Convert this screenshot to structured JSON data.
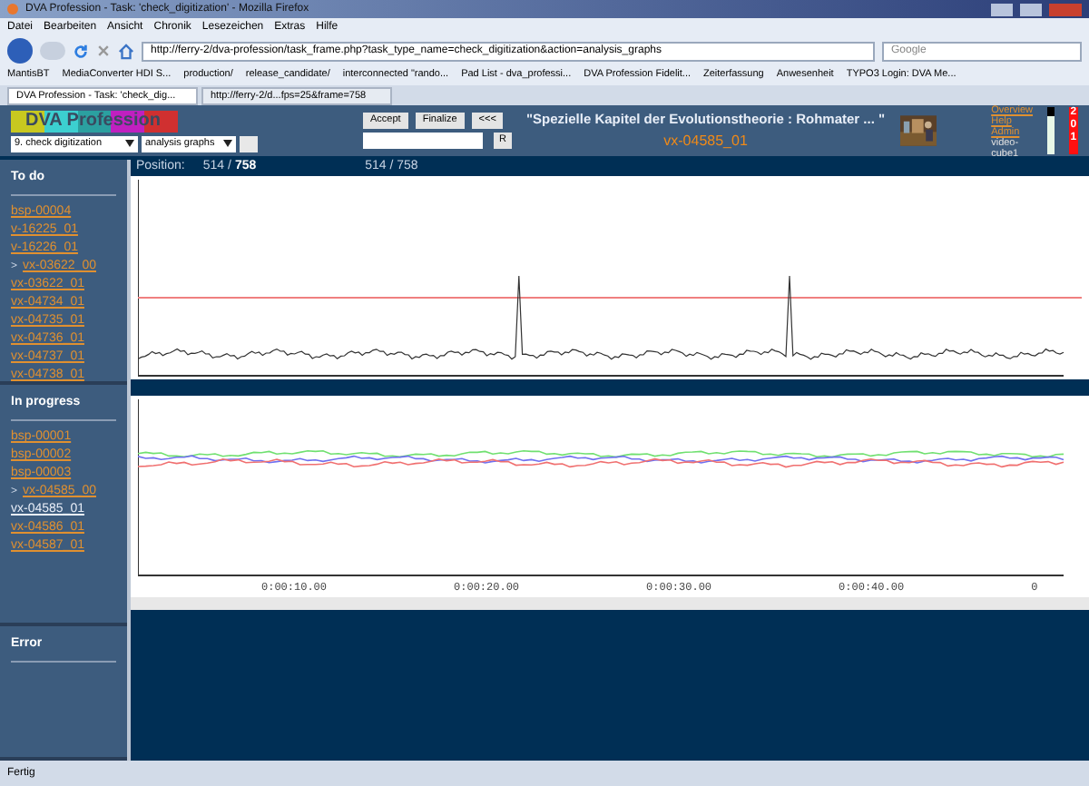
{
  "browser": {
    "title": "DVA Profession - Task: 'check_digitization' - Mozilla Firefox",
    "menu": [
      "Datei",
      "Bearbeiten",
      "Ansicht",
      "Chronik",
      "Lesezeichen",
      "Extras",
      "Hilfe"
    ],
    "url": "http://ferry-2/dva-profession/task_frame.php?task_type_name=check_digitization&action=analysis_graphs",
    "search": {
      "placeholder": "Google"
    },
    "bookmarks": [
      "MantisBT",
      "MediaConverter HDI S...",
      "production/",
      "release_candidate/",
      "interconnected \"rando...",
      "Pad List - dva_professi...",
      "DVA Profession Fidelit...",
      "Zeiterfassung",
      "Anwesenheit",
      "TYPO3 Login: DVA Me..."
    ],
    "tabs": [
      {
        "label": "DVA Profession - Task: 'check_dig...",
        "selected": true
      },
      {
        "label": "http://ferry-2/d...fps=25&frame=758",
        "selected": false
      }
    ],
    "status": "Fertig"
  },
  "header": {
    "logo": "DVA Profession",
    "selects": [
      "9. check digitization",
      "analysis graphs"
    ],
    "buttons": [
      "Accept",
      "Finalize",
      "<<<"
    ],
    "reset": "R",
    "title": "\"Spezielle Kapitel der Evolutionstheorie : Rohmater ... \"",
    "video_id": "vx-04585_01",
    "links": [
      "Overview",
      "Help",
      "Admin"
    ],
    "user": "video-cube1",
    "counter": "201"
  },
  "sidebar": [
    {
      "title": "To do",
      "items": [
        {
          "label": "bsp-00004",
          "selected": false
        },
        {
          "label": "v-16225_01",
          "selected": false
        },
        {
          "label": "v-16226_01",
          "selected": false
        },
        {
          "label": "vx-03622_00",
          "prefix": ">",
          "selected": false
        },
        {
          "label": "vx-03622_01",
          "selected": false
        },
        {
          "label": "vx-04734_01",
          "selected": false
        },
        {
          "label": "vx-04735_01",
          "selected": false
        },
        {
          "label": "vx-04736_01",
          "selected": false
        },
        {
          "label": "vx-04737_01",
          "selected": false
        },
        {
          "label": "vx-04738_01",
          "selected": false
        }
      ]
    },
    {
      "title": "In progress",
      "items": [
        {
          "label": "bsp-00001",
          "selected": false
        },
        {
          "label": "bsp-00002",
          "selected": false
        },
        {
          "label": "bsp-00003",
          "selected": false
        },
        {
          "label": "vx-04585_00",
          "prefix": ">",
          "selected": false
        },
        {
          "label": "vx-04585_01",
          "selected": true
        },
        {
          "label": "vx-04586_01",
          "selected": false
        },
        {
          "label": "vx-04587_01",
          "selected": false
        }
      ]
    },
    {
      "title": "Error"
    }
  ],
  "position": {
    "label": "Position:",
    "current": "514 /",
    "total": "758",
    "frame": "514 / 758"
  },
  "timeline": {
    "ticks": [
      "0:00:10.00",
      "0:00:20.00",
      "0:00:30.00",
      "0:00:40.00",
      "0"
    ]
  }
}
